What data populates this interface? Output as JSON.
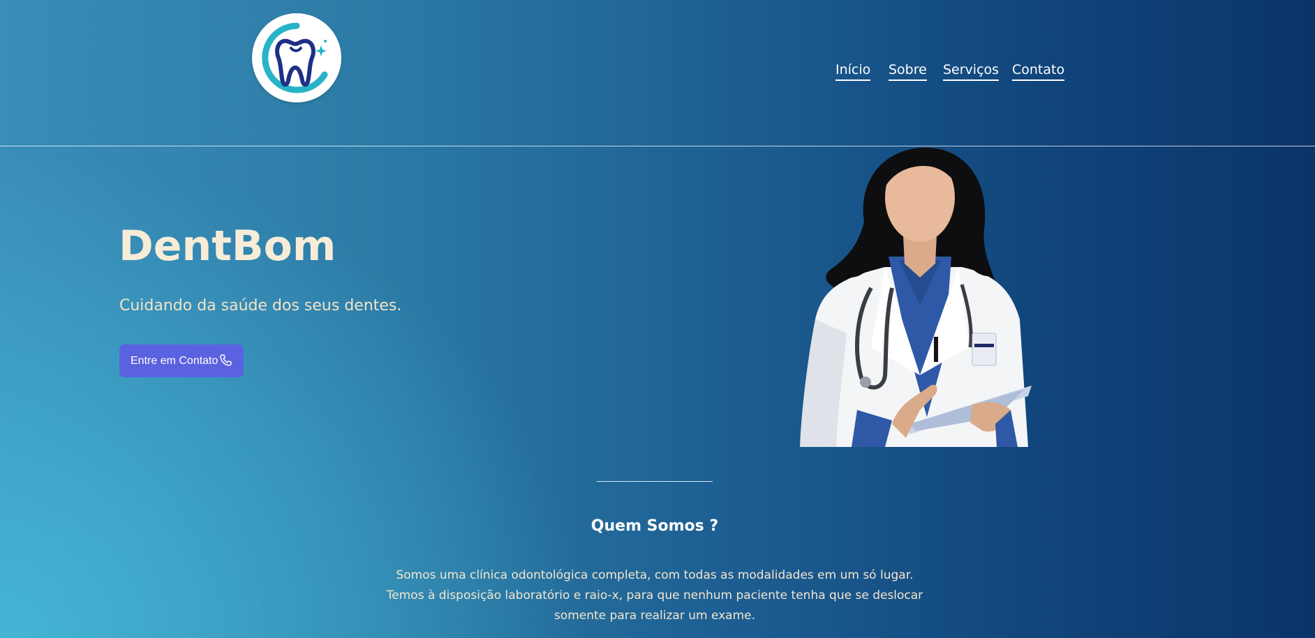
{
  "header": {
    "logo_icon": "tooth-logo-icon",
    "nav": [
      {
        "label": "Início"
      },
      {
        "label": "Sobre"
      },
      {
        "label": "Serviços"
      },
      {
        "label": "Contato"
      }
    ]
  },
  "hero": {
    "title": "DentBom",
    "subtitle": "Cuidando da saúde dos seus dentes.",
    "cta_label": "Entre em Contato",
    "cta_icon": "phone-icon",
    "illustration": "doctor-illustration"
  },
  "about": {
    "title": "Quem Somos ?",
    "text": "Somos uma clínica odontológica completa, com todas as modalidades em um só lugar. Temos à disposição laboratório e raio-x, para que nenhum paciente tenha que se deslocar somente para realizar um exame."
  },
  "colors": {
    "accent_button": "#5b62e0",
    "gradient_left": "#45b7d7",
    "gradient_right": "#0b3469",
    "text_cream": "#f7ecd8"
  }
}
